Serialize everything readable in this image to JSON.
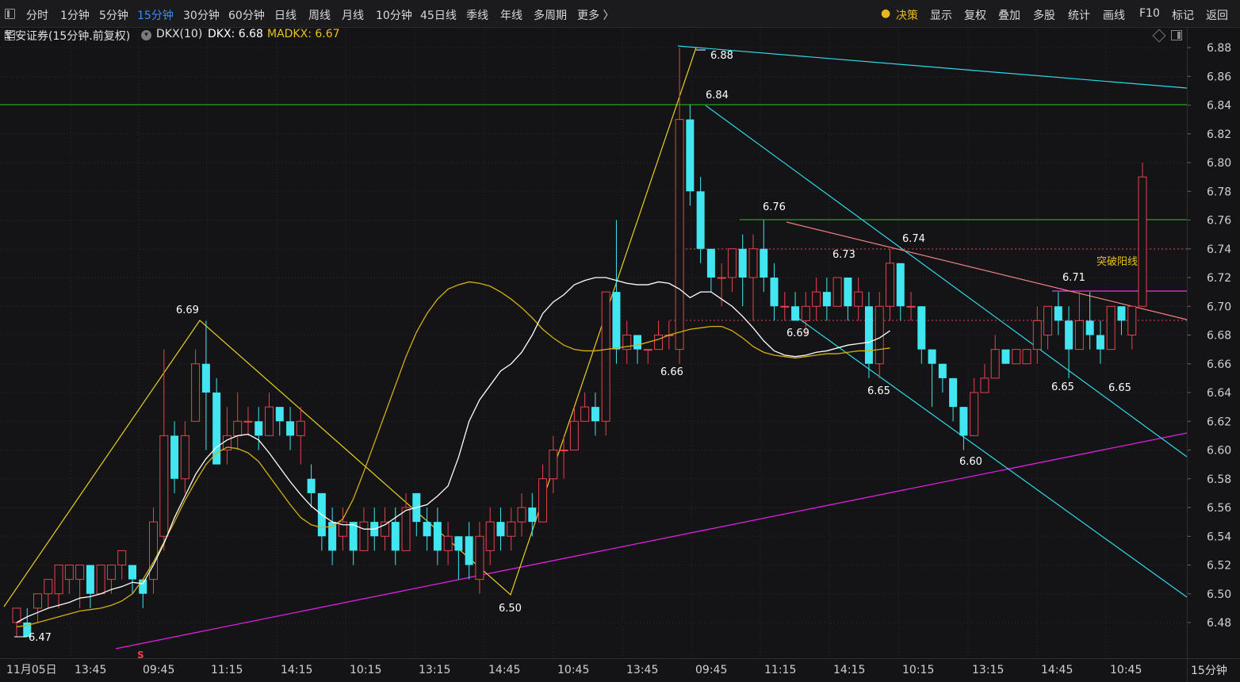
{
  "toolbar": {
    "periods": [
      "分时",
      "1分钟",
      "5分钟",
      "15分钟",
      "30分钟",
      "60分钟",
      "日线",
      "周线",
      "月线",
      "10分钟",
      "45日线",
      "季线",
      "年线",
      "多周期",
      "更多 〉"
    ],
    "active_period": "15分钟",
    "decision_label": "决策",
    "right_items": [
      "显示",
      "复权",
      "叠加",
      "多股",
      "统计",
      "画线",
      "F10",
      "标记",
      "返回"
    ]
  },
  "legend": {
    "stock": "华安证券(15分钟.前复权)",
    "indicator": "DKX(10)",
    "dkx": "DKX: 6.68",
    "madkx": "MADKX: 6.67"
  },
  "colors": {
    "up": "#e8414f",
    "down": "#41e6f0",
    "dkx": "#ffffff",
    "madkx": "#d4b010",
    "madkx_label": "#e8c020",
    "grid": "#2b2b2f",
    "toolbar_active": "#3d8bff"
  },
  "chart_data": {
    "type": "candlestick",
    "ylim": [
      6.465,
      6.895
    ],
    "y_ticks": [
      "6.48",
      "6.50",
      "6.52",
      "6.54",
      "6.56",
      "6.58",
      "6.60",
      "6.62",
      "6.64",
      "6.66",
      "6.68",
      "6.70",
      "6.72",
      "6.74",
      "6.76",
      "6.78",
      "6.80",
      "6.82",
      "6.84",
      "6.86",
      "6.88"
    ],
    "x_labels": [
      "11月05日",
      "13:45",
      "09:45",
      "11:15",
      "14:15",
      "10:15",
      "13:15",
      "14:45",
      "10:45",
      "13:45",
      "09:45",
      "11:15",
      "14:15",
      "10:15",
      "13:15",
      "14:45",
      "10:45"
    ],
    "period_label": "15分钟",
    "candles": [
      [
        6.48,
        6.49,
        6.47,
        6.48
      ],
      [
        6.48,
        6.47,
        6.49,
        6.47
      ],
      [
        6.49,
        6.5,
        6.48,
        6.5
      ],
      [
        6.5,
        6.51,
        6.49,
        6.51
      ],
      [
        6.5,
        6.52,
        6.49,
        6.52
      ],
      [
        6.51,
        6.52,
        6.5,
        6.51
      ],
      [
        6.51,
        6.52,
        6.49,
        6.51
      ],
      [
        6.52,
        6.5,
        6.49,
        6.52
      ],
      [
        6.5,
        6.52,
        6.5,
        6.52
      ],
      [
        6.51,
        6.52,
        6.5,
        6.52
      ],
      [
        6.52,
        6.53,
        6.51,
        6.53
      ],
      [
        6.52,
        6.51,
        6.5,
        6.52
      ],
      [
        6.51,
        6.5,
        6.49,
        6.51
      ],
      [
        6.51,
        6.55,
        6.5,
        6.56
      ],
      [
        6.54,
        6.61,
        6.53,
        6.67
      ],
      [
        6.61,
        6.58,
        6.57,
        6.62
      ],
      [
        6.58,
        6.61,
        6.57,
        6.62
      ],
      [
        6.62,
        6.66,
        6.62,
        6.67
      ],
      [
        6.66,
        6.64,
        6.6,
        6.69
      ],
      [
        6.64,
        6.59,
        6.59,
        6.65
      ],
      [
        6.6,
        6.61,
        6.59,
        6.63
      ],
      [
        6.61,
        6.62,
        6.6,
        6.64
      ],
      [
        6.62,
        6.62,
        6.61,
        6.63
      ],
      [
        6.62,
        6.61,
        6.6,
        6.63
      ],
      [
        6.61,
        6.63,
        6.61,
        6.64
      ],
      [
        6.63,
        6.62,
        6.61,
        6.63
      ],
      [
        6.62,
        6.61,
        6.6,
        6.63
      ],
      [
        6.61,
        6.62,
        6.59,
        6.63
      ],
      [
        6.58,
        6.57,
        6.56,
        6.59
      ],
      [
        6.57,
        6.54,
        6.53,
        6.57
      ],
      [
        6.55,
        6.53,
        6.52,
        6.56
      ],
      [
        6.54,
        6.55,
        6.53,
        6.56
      ],
      [
        6.55,
        6.53,
        6.52,
        6.55
      ],
      [
        6.53,
        6.55,
        6.53,
        6.56
      ],
      [
        6.55,
        6.54,
        6.53,
        6.56
      ],
      [
        6.54,
        6.55,
        6.53,
        6.56
      ],
      [
        6.55,
        6.53,
        6.52,
        6.56
      ],
      [
        6.53,
        6.56,
        6.53,
        6.57
      ],
      [
        6.57,
        6.55,
        6.54,
        6.57
      ],
      [
        6.55,
        6.54,
        6.53,
        6.56
      ],
      [
        6.55,
        6.53,
        6.52,
        6.56
      ],
      [
        6.53,
        6.54,
        6.52,
        6.55
      ],
      [
        6.54,
        6.53,
        6.51,
        6.54
      ],
      [
        6.54,
        6.52,
        6.51,
        6.55
      ],
      [
        6.51,
        6.54,
        6.5,
        6.55
      ],
      [
        6.53,
        6.55,
        6.52,
        6.56
      ],
      [
        6.55,
        6.54,
        6.53,
        6.56
      ],
      [
        6.54,
        6.55,
        6.53,
        6.56
      ],
      [
        6.55,
        6.56,
        6.54,
        6.57
      ],
      [
        6.56,
        6.55,
        6.54,
        6.57
      ],
      [
        6.55,
        6.58,
        6.55,
        6.59
      ],
      [
        6.58,
        6.6,
        6.57,
        6.61
      ],
      [
        6.6,
        6.6,
        6.58,
        6.61
      ],
      [
        6.6,
        6.62,
        6.6,
        6.63
      ],
      [
        6.62,
        6.63,
        6.62,
        6.64
      ],
      [
        6.63,
        6.62,
        6.61,
        6.64
      ],
      [
        6.62,
        6.71,
        6.61,
        6.71
      ],
      [
        6.71,
        6.67,
        6.66,
        6.76
      ],
      [
        6.67,
        6.68,
        6.66,
        6.69
      ],
      [
        6.68,
        6.67,
        6.66,
        6.68
      ],
      [
        6.67,
        6.67,
        6.66,
        6.67
      ],
      [
        6.67,
        6.68,
        6.67,
        6.69
      ],
      [
        6.68,
        6.68,
        6.67,
        6.69
      ],
      [
        6.67,
        6.83,
        6.66,
        6.88
      ],
      [
        6.83,
        6.78,
        6.77,
        6.84
      ],
      [
        6.78,
        6.74,
        6.73,
        6.79
      ],
      [
        6.74,
        6.72,
        6.71,
        6.74
      ],
      [
        6.72,
        6.72,
        6.7,
        6.73
      ],
      [
        6.72,
        6.74,
        6.71,
        6.74
      ],
      [
        6.74,
        6.72,
        6.7,
        6.75
      ],
      [
        6.72,
        6.74,
        6.69,
        6.75
      ],
      [
        6.74,
        6.72,
        6.71,
        6.76
      ],
      [
        6.72,
        6.7,
        6.69,
        6.73
      ],
      [
        6.7,
        6.7,
        6.69,
        6.71
      ],
      [
        6.7,
        6.69,
        6.69,
        6.71
      ],
      [
        6.69,
        6.7,
        6.68,
        6.71
      ],
      [
        6.7,
        6.71,
        6.69,
        6.72
      ],
      [
        6.71,
        6.7,
        6.69,
        6.72
      ],
      [
        6.7,
        6.72,
        6.7,
        6.72
      ],
      [
        6.72,
        6.7,
        6.69,
        6.72
      ],
      [
        6.7,
        6.71,
        6.69,
        6.72
      ],
      [
        6.7,
        6.66,
        6.65,
        6.71
      ],
      [
        6.66,
        6.7,
        6.65,
        6.71
      ],
      [
        6.7,
        6.73,
        6.69,
        6.74
      ],
      [
        6.73,
        6.7,
        6.69,
        6.73
      ],
      [
        6.7,
        6.7,
        6.69,
        6.71
      ],
      [
        6.7,
        6.67,
        6.66,
        6.7
      ],
      [
        6.67,
        6.66,
        6.63,
        6.67
      ],
      [
        6.66,
        6.65,
        6.64,
        6.66
      ],
      [
        6.65,
        6.63,
        6.62,
        6.65
      ],
      [
        6.63,
        6.61,
        6.6,
        6.63
      ],
      [
        6.61,
        6.64,
        6.61,
        6.65
      ],
      [
        6.64,
        6.65,
        6.64,
        6.66
      ],
      [
        6.65,
        6.67,
        6.65,
        6.68
      ],
      [
        6.67,
        6.66,
        6.66,
        6.67
      ],
      [
        6.66,
        6.67,
        6.66,
        6.67
      ],
      [
        6.66,
        6.67,
        6.66,
        6.67
      ],
      [
        6.67,
        6.69,
        6.66,
        6.7
      ],
      [
        6.68,
        6.7,
        6.67,
        6.7
      ],
      [
        6.7,
        6.69,
        6.68,
        6.71
      ],
      [
        6.69,
        6.67,
        6.65,
        6.7
      ],
      [
        6.67,
        6.69,
        6.67,
        6.71
      ],
      [
        6.69,
        6.68,
        6.67,
        6.71
      ],
      [
        6.68,
        6.67,
        6.66,
        6.69
      ],
      [
        6.67,
        6.7,
        6.67,
        6.7
      ],
      [
        6.7,
        6.69,
        6.68,
        6.7
      ],
      [
        6.68,
        6.7,
        6.67,
        6.7
      ],
      [
        6.7,
        6.79,
        6.7,
        6.8
      ]
    ],
    "series": [
      {
        "name": "DKX",
        "values": [
          6.48,
          6.484,
          6.487,
          6.49,
          6.492,
          6.494,
          6.497,
          6.498,
          6.5,
          6.503,
          6.505,
          6.508,
          6.507,
          6.52,
          6.535,
          6.553,
          6.568,
          6.583,
          6.594,
          6.602,
          6.607,
          6.61,
          6.611,
          6.607,
          6.598,
          6.588,
          6.578,
          6.569,
          6.561,
          6.555,
          6.55,
          6.548,
          6.548,
          6.545,
          6.545,
          6.548,
          6.553,
          6.558,
          6.56,
          6.562,
          6.568,
          6.575,
          6.595,
          6.62,
          6.635,
          6.645,
          6.655,
          6.66,
          6.668,
          6.68,
          6.695,
          6.703,
          6.708,
          6.715,
          6.718,
          6.72,
          6.72,
          6.718,
          6.716,
          6.715,
          6.715,
          6.717,
          6.716,
          6.712,
          6.706,
          6.71,
          6.71,
          6.705,
          6.7,
          6.693,
          6.685,
          6.676,
          6.669,
          6.666,
          6.665,
          6.666,
          6.668,
          6.669,
          6.671,
          6.673,
          6.674,
          6.675,
          6.678,
          6.683
        ]
      },
      {
        "name": "MADKX",
        "values": [
          6.477,
          6.478,
          6.48,
          6.482,
          6.484,
          6.486,
          6.488,
          6.489,
          6.49,
          6.492,
          6.495,
          6.5,
          6.51,
          6.522,
          6.536,
          6.55,
          6.565,
          6.578,
          6.59,
          6.598,
          6.602,
          6.601,
          6.598,
          6.592,
          6.582,
          6.572,
          6.562,
          6.553,
          6.548,
          6.546,
          6.547,
          6.552,
          6.566,
          6.585,
          6.605,
          6.625,
          6.645,
          6.665,
          6.682,
          6.695,
          6.705,
          6.712,
          6.715,
          6.717,
          6.716,
          6.714,
          6.71,
          6.705,
          6.699,
          6.692,
          6.684,
          6.678,
          6.673,
          6.67,
          6.669,
          6.669,
          6.67,
          6.671,
          6.672,
          6.673,
          6.675,
          6.677,
          6.68,
          6.682,
          6.684,
          6.685,
          6.686,
          6.686,
          6.683,
          6.678,
          6.672,
          6.668,
          6.666,
          6.665,
          6.664,
          6.665,
          6.666,
          6.667,
          6.667,
          6.668,
          6.669,
          6.669,
          6.67,
          6.671
        ]
      }
    ],
    "price_labels": [
      "6.47",
      "6.69",
      "6.50",
      "6.88",
      "6.84",
      "6.66",
      "6.76",
      "6.73",
      "6.74",
      "6.69",
      "6.65",
      "6.60",
      "6.71",
      "6.65",
      "6.65"
    ],
    "annotation": "突破阳线",
    "signal_marker": "S"
  }
}
